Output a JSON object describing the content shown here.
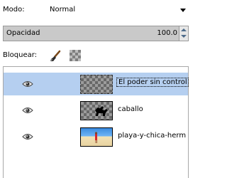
{
  "mode": {
    "label": "Modo:",
    "value": "Normal"
  },
  "opacity": {
    "label": "Opacidad",
    "value": "100.0"
  },
  "lock": {
    "label": "Bloquear:"
  },
  "layers": [
    {
      "name": "El poder sin control no",
      "selected": true,
      "thumbnail": "checker"
    },
    {
      "name": "caballo",
      "selected": false,
      "thumbnail": "checker-with-horse"
    },
    {
      "name": "playa-y-chica-hermosa",
      "selected": false,
      "thumbnail": "beach-photo"
    }
  ],
  "icons": {
    "visibility": "eye-icon",
    "lock_pixels": "paintbrush-icon",
    "lock_alpha": "checker-icon"
  },
  "colors": {
    "selection": "#b5cff0",
    "opacity_bar": "#c9c9c9"
  }
}
